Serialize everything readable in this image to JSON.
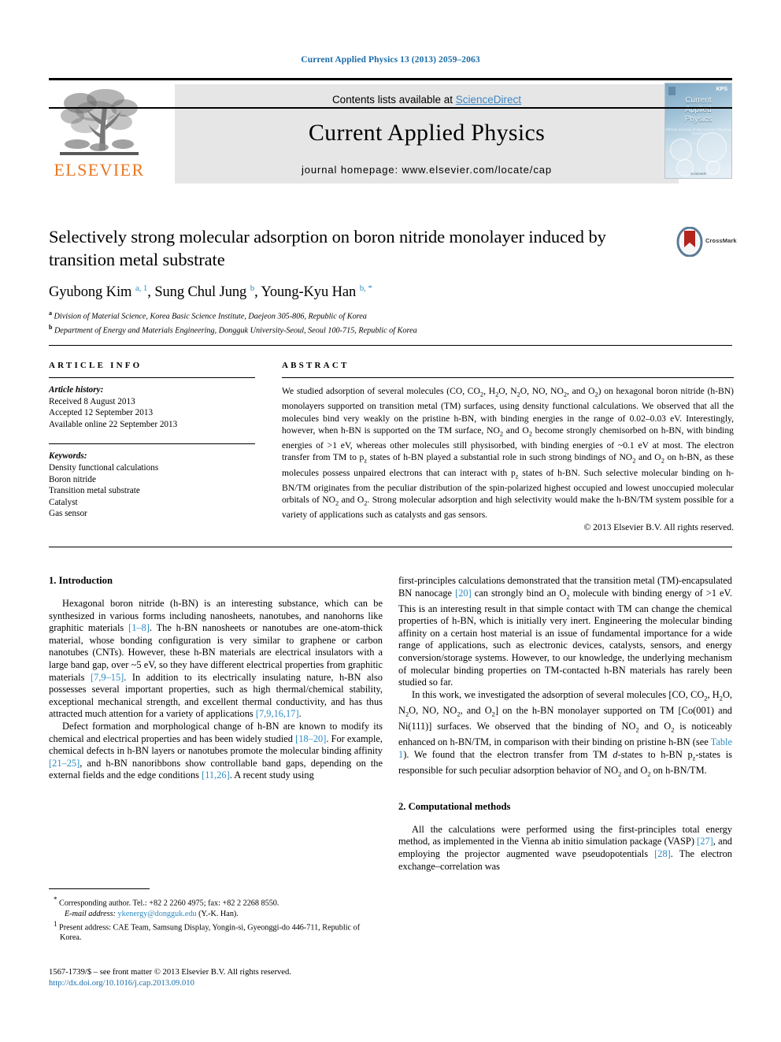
{
  "running_head": "Current Applied Physics 13 (2013) 2059–2063",
  "masthead": {
    "publisher": "ELSEVIER",
    "contents_prefix": "Contents lists available at ",
    "contents_link": "ScienceDirect",
    "journal_title": "Current Applied Physics",
    "homepage": "journal homepage: www.elsevier.com/locate/cap",
    "cover": {
      "title_line1": "Current",
      "title_line2": "Applied",
      "title_line3": "Physics",
      "subtitle": "Official Journal of the Korean Physical Society",
      "badge": "KPS",
      "footer": "ELSEVIER"
    }
  },
  "article": {
    "title": "Selectively strong molecular adsorption on boron nitride monolayer induced by transition metal substrate",
    "authors_html": "Gyubong Kim <sup class=\"aff-mark\">a, 1</sup>, Sung Chul Jung <sup class=\"aff-mark\">b</sup>, Young-Kyu Han <sup class=\"aff-mark\">b, *</sup>",
    "affiliation_a": "Division of Material Science, Korea Basic Science Institute, Daejeon 305-806, Republic of Korea",
    "affiliation_b": "Department of Energy and Materials Engineering, Dongguk University-Seoul, Seoul 100-715, Republic of Korea",
    "crossmark_label": "CrossMark"
  },
  "info": {
    "heading": "ARTICLE INFO",
    "history_label": "Article history:",
    "received": "Received 8 August 2013",
    "accepted": "Accepted 12 September 2013",
    "available": "Available online 22 September 2013",
    "keywords_label": "Keywords:",
    "keywords": [
      "Density functional calculations",
      "Boron nitride",
      "Transition metal substrate",
      "Catalyst",
      "Gas sensor"
    ]
  },
  "abstract": {
    "heading": "ABSTRACT",
    "text_html": "We studied adsorption of several molecules (CO, CO<sub>2</sub>, H<sub>2</sub>O, N<sub>2</sub>O, NO, NO<sub>2</sub>, and O<sub>2</sub>) on hexagonal boron nitride (h-BN) monolayers supported on transition metal (TM) surfaces, using density functional calculations. We observed that all the molecules bind very weakly on the pristine h-BN, with binding energies in the range of 0.02–0.03 eV. Interestingly, however, when h-BN is supported on the TM surface, NO<sub>2</sub> and O<sub>2</sub> become strongly chemisorbed on h-BN, with binding energies of &gt;1 eV, whereas other molecules still physisorbed, with binding energies of ~0.1 eV at most. The electron transfer from TM to p<sub>z</sub> states of h-BN played a substantial role in such strong bindings of NO<sub>2</sub> and O<sub>2</sub> on h-BN, as these molecules possess unpaired electrons that can interact with p<sub>z</sub> states of h-BN. Such selective molecular binding on h-BN/TM originates from the peculiar distribution of the spin-polarized highest occupied and lowest unoccupied molecular orbitals of NO<sub>2</sub> and O<sub>2</sub>. Strong molecular adsorption and high selectivity would make the h-BN/TM system possible for a variety of applications such as catalysts and gas sensors.",
    "copyright": "© 2013 Elsevier B.V. All rights reserved."
  },
  "sections": {
    "intro_heading": "1. Introduction",
    "methods_heading": "2. Computational methods",
    "intro_p1_html": "Hexagonal boron nitride (h-BN) is an interesting substance, which can be synthesized in various forms including nanosheets, nanotubes, and nanohorns like graphitic materials <span class=\"ref\">[1–8]</span>. The h-BN nanosheets or nanotubes are one-atom-thick material, whose bonding configuration is very similar to graphene or carbon nanotubes (CNTs). However, these h-BN materials are electrical insulators with a large band gap, over ~5 eV, so they have different electrical properties from graphitic materials <span class=\"ref\">[7,9–15]</span>. In addition to its electrically insulating nature, h-BN also possesses several important properties, such as high thermal/chemical stability, exceptional mechanical strength, and excellent thermal conductivity, and has thus attracted much attention for a variety of applications <span class=\"ref\">[7,9,16,17]</span>.",
    "intro_p2_html": "Defect formation and morphological change of h-BN are known to modify its chemical and electrical properties and has been widely studied <span class=\"ref\">[18–20]</span>. For example, chemical defects in h-BN layers or nanotubes promote the molecular binding affinity <span class=\"ref\">[21–25]</span>, and h-BN nanoribbons show controllable band gaps, depending on the external fields and the edge conditions <span class=\"ref\">[11,26]</span>. A recent study using",
    "intro_p3_html": "first-principles calculations demonstrated that the transition metal (TM)-encapsulated BN nanocage <span class=\"ref\">[20]</span> can strongly bind an O<sub>2</sub> molecule with binding energy of &gt;1 eV. This is an interesting result in that simple contact with TM can change the chemical properties of h-BN, which is initially very inert. Engineering the molecular binding affinity on a certain host material is an issue of fundamental importance for a wide range of applications, such as electronic devices, catalysts, sensors, and energy conversion/storage systems. However, to our knowledge, the underlying mechanism of molecular binding properties on TM-contacted h-BN materials has rarely been studied so far.",
    "intro_p4_html": "In this work, we investigated the adsorption of several molecules [CO, CO<sub>2</sub>, H<sub>2</sub>O, N<sub>2</sub>O, NO, NO<sub>2</sub>, and O<sub>2</sub>] on the h-BN monolayer supported on TM [Co(001) and Ni(111)] surfaces. We observed that the binding of NO<sub>2</sub> and O<sub>2</sub> is noticeably enhanced on h-BN/TM, in comparison with their binding on pristine h-BN (see <span class=\"ref\">Table 1</span>). We found that the electron transfer from TM <i>d</i>-states to h-BN p<sub>z</sub>-states is responsible for such peculiar adsorption behavior of NO<sub>2</sub> and O<sub>2</sub> on h-BN/TM.",
    "methods_p1_html": "All the calculations were performed using the first-principles total energy method, as implemented in the Vienna ab initio simulation package (VASP) <span class=\"ref\">[27]</span>, and employing the projector augmented wave pseudopotentials <span class=\"ref\">[28]</span>. The electron exchange–correlation was"
  },
  "footnotes": {
    "corresponding_html": "<span class=\"mark\">*</span> Corresponding author. Tel.: +82 2 2260 4975; fax: +82 2 2268 8550.",
    "email_html": "<span class=\"ital\">E-mail address:</span> <span class=\"link\">ykenergy@dongguk.edu</span> (Y.-K. Han).",
    "present_address_html": "<span class=\"mark\">1</span> Present address: CAE Team, Samsung Display, Yongin-si, Gyeonggi-do 446-711, Republic of Korea.",
    "issn_line": "1567-1739/$ – see front matter © 2013 Elsevier B.V. All rights reserved.",
    "doi": "http://dx.doi.org/10.1016/j.cap.2013.09.010"
  },
  "colors": {
    "link_blue": "#2e8bc0",
    "head_blue": "#1b6ca8",
    "elsevier_orange": "#e87722",
    "panel_gray": "#e6e6e6"
  }
}
